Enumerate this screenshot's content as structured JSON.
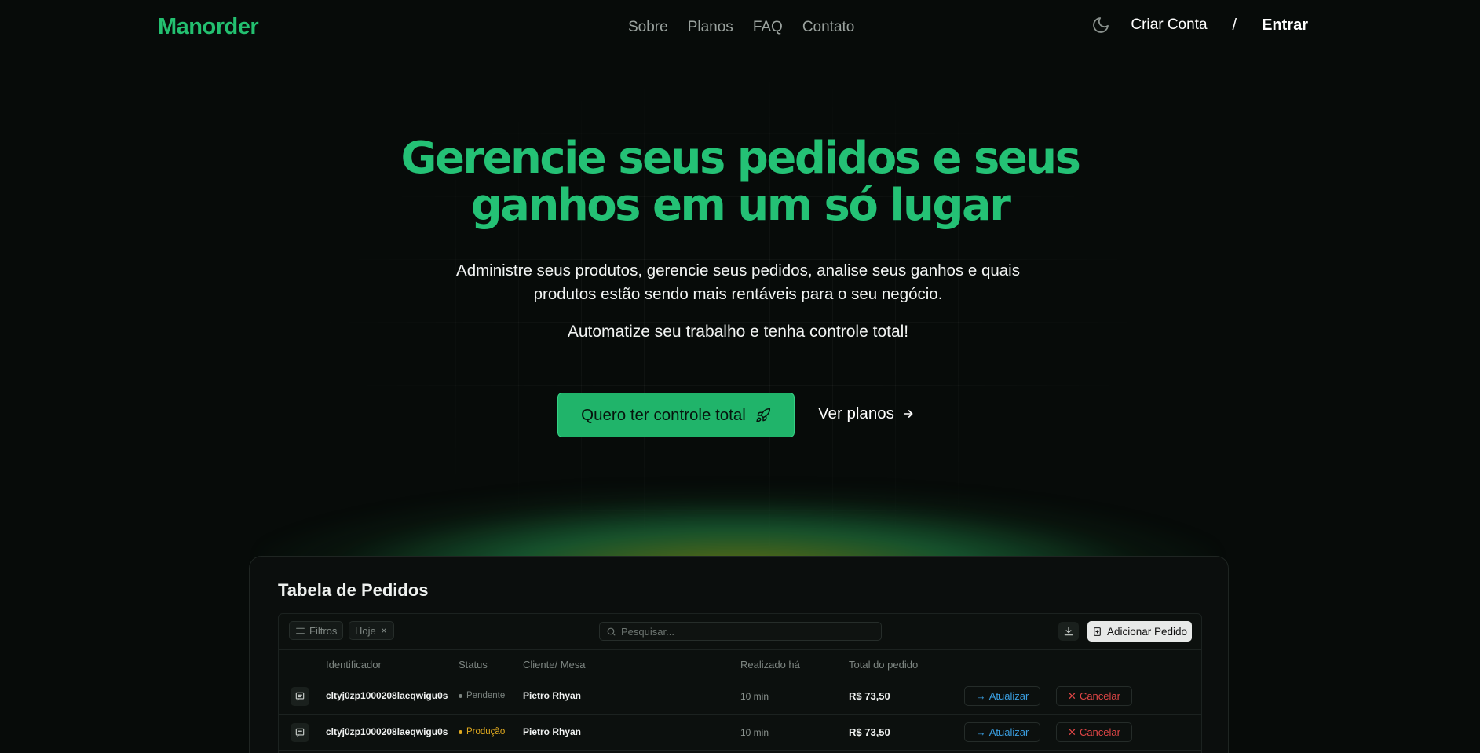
{
  "brand": {
    "name": "Manorder",
    "accent": "#23c070"
  },
  "nav": {
    "links": [
      "Sobre",
      "Planos",
      "FAQ",
      "Contato"
    ],
    "theme_icon": "moon-icon",
    "signup": "Criar Conta",
    "separator": "/",
    "login": "Entrar"
  },
  "hero": {
    "title_line1": "Gerencie seus pedidos e seus",
    "title_line2": "ganhos em um só lugar",
    "subtitle_line1": "Administre seus produtos, gerencie seus pedidos, analise seus ganhos e quais",
    "subtitle_line2": "produtos estão sendo mais rentáveis para o seu negócio.",
    "tagline": "Automatize seu trabalho e tenha controle total!",
    "cta_primary": "Quero ter controle total",
    "cta_primary_icon": "rocket-icon",
    "cta_secondary": "Ver planos",
    "cta_secondary_icon": "arrow-right-icon"
  },
  "table_card": {
    "title": "Tabela de Pedidos",
    "toolbar": {
      "filters_label": "Filtros",
      "active_filter": "Hoje",
      "search_placeholder": "Pesquisar...",
      "add_button": "Adicionar Pedido"
    },
    "columns": [
      "Identificador",
      "Status",
      "Cliente/ Mesa",
      "Realizado há",
      "Total do pedido"
    ],
    "rows": [
      {
        "id": "cltyj0zp1000208laeqwigu0s",
        "status": "Pendente",
        "status_color": "#7d8581",
        "client": "Pietro Rhyan",
        "time": "10 min",
        "total": "R$ 73,50",
        "update_label": "Atualizar",
        "cancel_label": "Cancelar"
      },
      {
        "id": "cltyj0zp1000208laeqwigu0s",
        "status": "Produção",
        "status_color": "#e0a91f",
        "client": "Pietro Rhyan",
        "time": "10 min",
        "total": "R$ 73,50",
        "update_label": "Atualizar",
        "cancel_label": "Cancelar"
      }
    ]
  }
}
